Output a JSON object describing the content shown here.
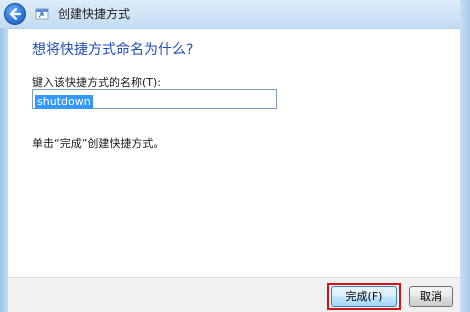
{
  "window": {
    "title": "创建快捷方式"
  },
  "wizard": {
    "heading": "想将快捷方式命名为什么?",
    "name_label": "键入该快捷方式的名称(T):",
    "name_value": "shutdown",
    "hint": "单击“完成”创建快捷方式。"
  },
  "buttons": {
    "finish_label": "完成(F)",
    "cancel_label": "取消"
  },
  "icons": {
    "back": "back-arrow-icon",
    "wizard": "shortcut-wizard-icon"
  },
  "colors": {
    "heading": "#1f4fb5",
    "selection": "#3399ff",
    "highlight_box": "#d0141a"
  }
}
